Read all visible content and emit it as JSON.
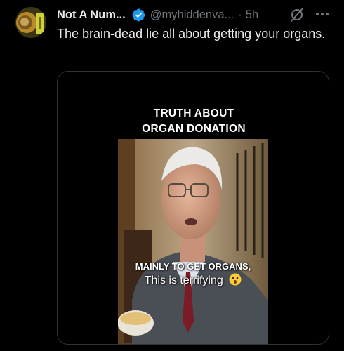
{
  "author": {
    "display_name": "Not A Num...",
    "handle": "@myhiddenva...",
    "separator": "·",
    "time": "5h"
  },
  "tweet": {
    "text": "The brain-dead lie all about getting your organs."
  },
  "video": {
    "title_line1": "TRUTH ABOUT",
    "title_line2": "ORGAN DONATION",
    "caption_line1": "MAINLY TO GET ORGANS,",
    "caption_line2": "This is terrifying",
    "caption_emoji": "astonished-face-icon"
  },
  "icons": {
    "verified": "verified-badge-icon",
    "grok": "grok-icon",
    "more": "more-icon"
  },
  "colors": {
    "background": "#000000",
    "primary_text": "#e7e9ea",
    "secondary_text": "#71767b",
    "verified_blue": "#1d9bf0",
    "card_border": "#2f3336"
  }
}
